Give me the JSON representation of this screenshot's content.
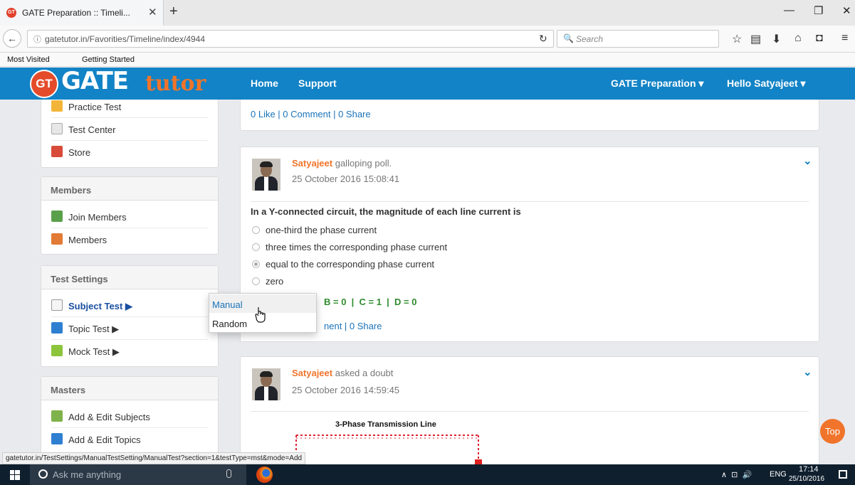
{
  "browser": {
    "tab_title": "GATE Preparation :: Timeli...",
    "tab_close": "✕",
    "new_tab": "+",
    "window_controls": {
      "minimize": "—",
      "restore": "❐",
      "close": "✕"
    },
    "back": "←",
    "url_info_icon": "ⓘ",
    "url": "gatetutor.in/Favorities/Timeline/index/4944",
    "reload": "↻",
    "search_icon": "🔍",
    "search_placeholder": "Search",
    "toolbar_icons": {
      "bookmark": "☆",
      "reading": "▤",
      "download": "⬇",
      "home": "⌂",
      "pocket": "◘",
      "menu": "≡"
    },
    "bookmarks": [
      "Most Visited",
      "Getting Started"
    ]
  },
  "header": {
    "logo_gt": "GT",
    "logo_gate": "GATE",
    "logo_tutor": "tutor",
    "nav": [
      "Home",
      "Support"
    ],
    "gate_prep": "GATE Preparation ▾",
    "user_menu": "Hello Satyajeet ▾"
  },
  "sidebar": {
    "top_items": [
      "Practice Test",
      "Test Center",
      "Store"
    ],
    "members": {
      "title": "Members",
      "items": [
        "Join Members",
        "Members"
      ]
    },
    "test_settings": {
      "title": "Test Settings",
      "items": [
        "Subject Test ▶",
        "Topic Test ▶",
        "Mock Test ▶"
      ]
    },
    "masters": {
      "title": "Masters",
      "items": [
        "Add & Edit Subjects",
        "Add & Edit Topics"
      ]
    }
  },
  "cards": [
    {
      "stats": "0 Like | 0 Comment | 0 Share"
    },
    {
      "author": "Satyajeet",
      "action": "galloping poll.",
      "date": "25 October 2016 15:08:41",
      "question": "In a Y-connected circuit, the magnitude of each line current is",
      "options": [
        "one-third the phase current",
        "three times the corresponding phase current",
        "equal to the corresponding phase current",
        "zero"
      ],
      "selected_option": 2,
      "result_partial": "B = 0  |  C = 1  |  D = 0",
      "stats_partial": "nent | 0 Share"
    },
    {
      "author": "Satyajeet",
      "action": "asked a doubt",
      "date": "25 October 2016 14:59:45",
      "image_title": "3-Phase Transmission Line"
    }
  ],
  "chevron": "⌄",
  "dropdown": {
    "items": [
      "Manual",
      "Random"
    ]
  },
  "top_button": "Top",
  "status_url": "gatetutor.in/TestSettings/ManualTestSetting/ManualTest?section=1&testType=mst&mode=Add",
  "taskbar": {
    "search_placeholder": "Ask me anything",
    "tray_icons": "∧  ⊡  🔊",
    "lang": "ENG",
    "time": "17:14",
    "date": "25/10/2016"
  },
  "colors": {
    "brand_blue": "#1283c6",
    "accent_orange": "#f0742b",
    "answer_green": "#2e8b2e"
  }
}
